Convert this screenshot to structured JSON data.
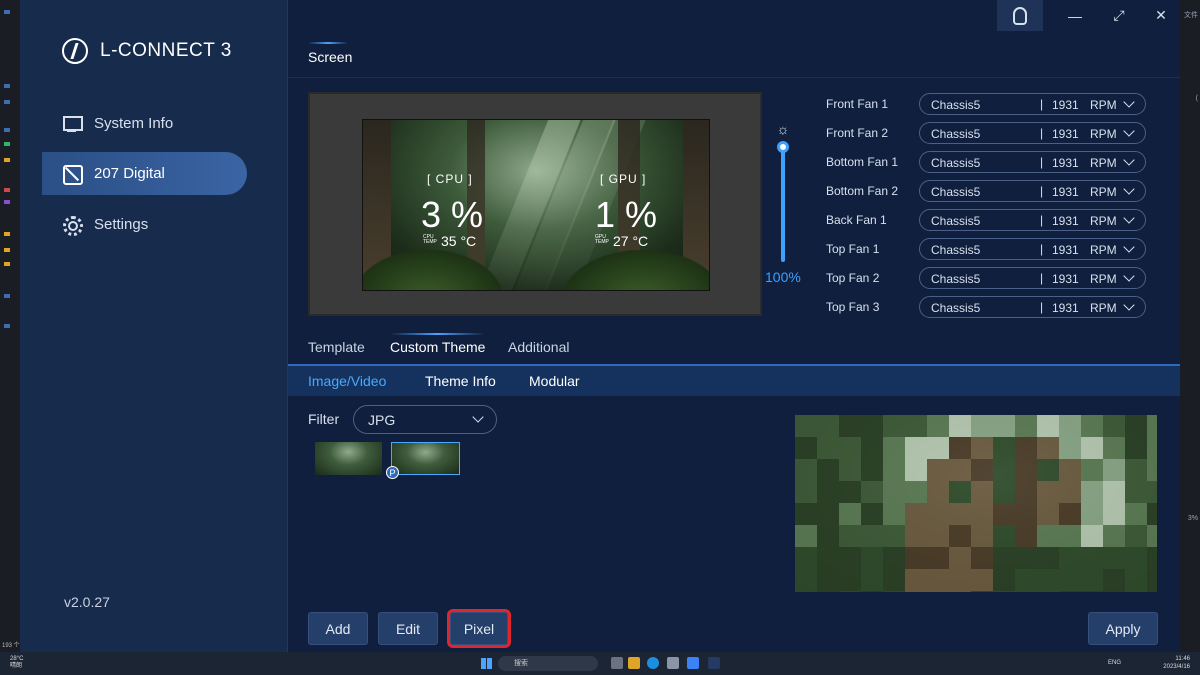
{
  "app": {
    "brand": "L-CONNECT 3",
    "version": "v2.0.27"
  },
  "sidebar": {
    "items": [
      {
        "label": "System Info",
        "icon": "monitor-icon"
      },
      {
        "label": "207 Digital",
        "icon": "screen-icon",
        "active": true
      },
      {
        "label": "Settings",
        "icon": "gear-icon"
      }
    ]
  },
  "header": {
    "section_title": "Screen",
    "buttons": {
      "minimize": "—",
      "maximize": "⤢",
      "close": "✕"
    }
  },
  "preview": {
    "cpu_label": "[ CPU ]",
    "cpu_value": "3 %",
    "cpu_temp_caption_1": "CPU",
    "cpu_temp_caption_2": "TEMP",
    "cpu_temp": "35 °C",
    "gpu_label": "[ GPU ]",
    "gpu_value": "1 %",
    "gpu_temp_caption_1": "GPU",
    "gpu_temp_caption_2": "TEMP",
    "gpu_temp": "27 °C"
  },
  "brightness": {
    "value_label": "100%",
    "level": 1.0
  },
  "fans": [
    {
      "name": "Front Fan 1",
      "mode": "Chassis5",
      "sep": "|",
      "rpm": "1931",
      "unit": "RPM"
    },
    {
      "name": "Front Fan 2",
      "mode": "Chassis5",
      "sep": "|",
      "rpm": "1931",
      "unit": "RPM"
    },
    {
      "name": "Bottom Fan 1",
      "mode": "Chassis5",
      "sep": "|",
      "rpm": "1931",
      "unit": "RPM"
    },
    {
      "name": "Bottom Fan 2",
      "mode": "Chassis5",
      "sep": "|",
      "rpm": "1931",
      "unit": "RPM"
    },
    {
      "name": "Back Fan 1",
      "mode": "Chassis5",
      "sep": "|",
      "rpm": "1931",
      "unit": "RPM"
    },
    {
      "name": "Top Fan 1",
      "mode": "Chassis5",
      "sep": "|",
      "rpm": "1931",
      "unit": "RPM"
    },
    {
      "name": "Top Fan 2",
      "mode": "Chassis5",
      "sep": "|",
      "rpm": "1931",
      "unit": "RPM"
    },
    {
      "name": "Top Fan 3",
      "mode": "Chassis5",
      "sep": "|",
      "rpm": "1931",
      "unit": "RPM"
    }
  ],
  "tabs": [
    "Template",
    "Custom Theme",
    "Additional"
  ],
  "active_tab": "Custom Theme",
  "subtabs": [
    "Image/Video",
    "Theme Info",
    "Modular"
  ],
  "active_subtab": "Image/Video",
  "filter": {
    "label": "Filter",
    "value": "JPG"
  },
  "thumb_badge": "P",
  "buttons": {
    "add": "Add",
    "edit": "Edit",
    "pixel": "Pixel",
    "apply": "Apply"
  },
  "taskbar": {
    "weather_temp": "28°C",
    "weather_text": "晴朗",
    "search_placeholder": "搜索",
    "lang": "ENG",
    "time": "11:46",
    "date": "2023/4/16"
  },
  "desktop": {
    "right_labels": [
      "文件",
      "(",
      "3%"
    ],
    "left_count": "193 个"
  },
  "colors": {
    "accent": "#3ea0ff",
    "highlight_box": "#e0262c",
    "sidebar_bg": "#172b4d",
    "main_bg": "#0f1f3d"
  }
}
